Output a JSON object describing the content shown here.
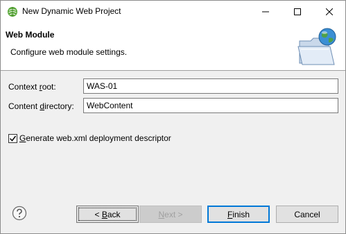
{
  "window": {
    "title": "New Dynamic Web Project"
  },
  "banner": {
    "title": "Web Module",
    "description": "Configure web module settings."
  },
  "form": {
    "context_root": {
      "label_pre": "Context ",
      "label_mnemonic": "r",
      "label_post": "oot:",
      "value": "WAS-01"
    },
    "content_directory": {
      "label_pre": "Content ",
      "label_mnemonic": "d",
      "label_post": "irectory:",
      "value": "WebContent"
    },
    "generate_descriptor": {
      "checked": true,
      "label_mnemonic": "G",
      "label_post": "enerate web.xml deployment descriptor"
    }
  },
  "buttons": {
    "back": {
      "pre": "< ",
      "mnemonic": "B",
      "post": "ack"
    },
    "next": {
      "mnemonic": "N",
      "post": "ext >"
    },
    "finish": {
      "mnemonic": "F",
      "post": "inish"
    },
    "cancel": {
      "label": "Cancel"
    }
  },
  "icons": {
    "app": "eclipse-globe-icon",
    "banner": "web-folder-globe-icon",
    "help": "help-icon"
  },
  "colors": {
    "focus_border": "#0078d7",
    "disabled_text": "#a0a0a0"
  }
}
